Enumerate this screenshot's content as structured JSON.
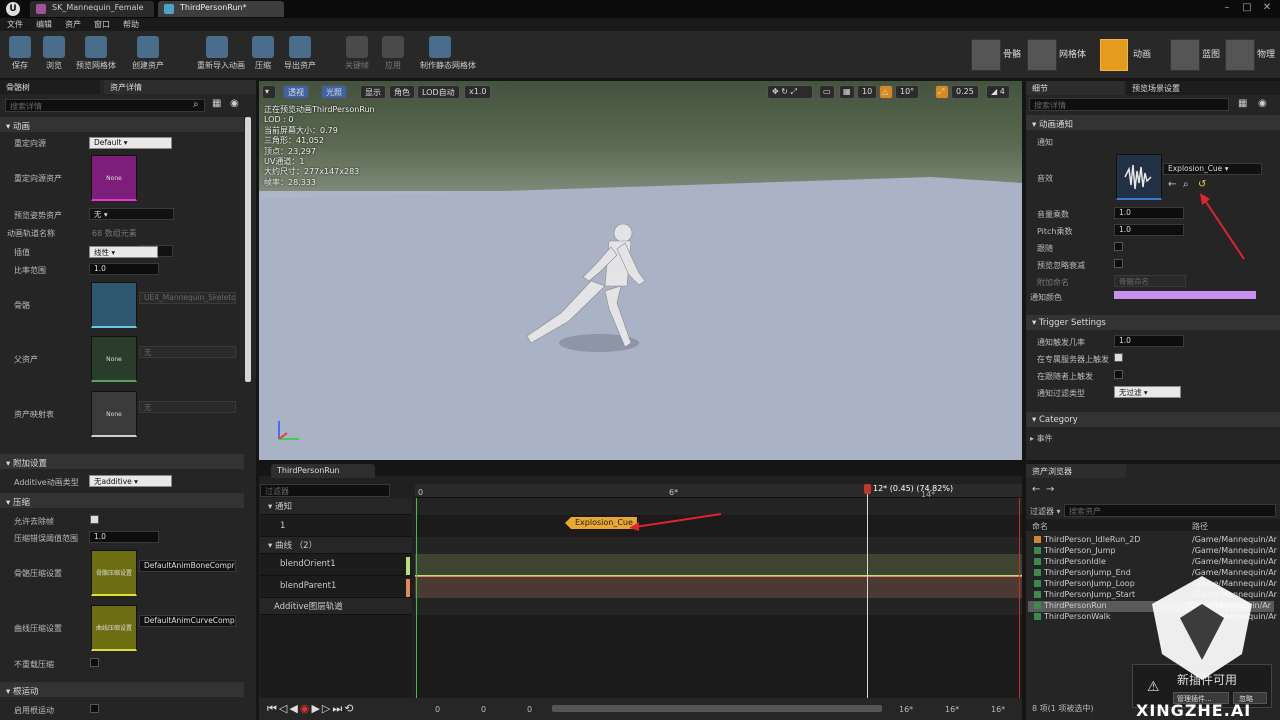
{
  "tabs": [
    "SK_Mannequin_Female",
    "ThirdPersonRun*"
  ],
  "menu": [
    "文件",
    "编辑",
    "资产",
    "窗口",
    "帮助"
  ],
  "toolbar": [
    {
      "label": "保存",
      "icon": "save-icon"
    },
    {
      "label": "浏览",
      "icon": "browse-icon"
    },
    {
      "label": "预览网格体",
      "icon": "preview-mesh-icon"
    },
    {
      "label": "创建资产",
      "icon": "create-asset-icon"
    },
    {
      "label": "重新导入动画",
      "icon": "reimport-icon"
    },
    {
      "label": "压缩",
      "icon": "compress-icon"
    },
    {
      "label": "导出资产",
      "icon": "export-icon"
    },
    {
      "label": "关键帧",
      "icon": "keyframe-icon",
      "disabled": true
    },
    {
      "label": "应用",
      "icon": "apply-icon",
      "disabled": true
    },
    {
      "label": "制作静态网格体",
      "icon": "static-mesh-icon"
    }
  ],
  "modes": [
    "骨骼",
    "网格体",
    "动画",
    "蓝图",
    "物理"
  ],
  "left": {
    "tabs": [
      "骨骼树",
      "资产详情"
    ],
    "search_placeholder": "搜索详情",
    "sec_animation": "动画",
    "retarget_source_label": "重定向源",
    "retarget_source_value": "Default",
    "retarget_asset_label": "重定向源资产",
    "retarget_asset_thumb": "None",
    "retarget_asset_value": "无",
    "preview_pose_label": "预览姿势资产",
    "preview_pose_value": "无",
    "track_names_label": "动画轨道名称",
    "track_names_value": "68 数组元素",
    "interp_label": "插值",
    "interp_value": "线性",
    "rate_label": "比率范围",
    "rate_value": "1.0",
    "skeleton_label": "骨骼",
    "skeleton_value": "UE4_Mannequin_Skeleton",
    "parent_label": "父资产",
    "parent_thumb": "None",
    "parent_value": "无",
    "mapping_label": "资产映射表",
    "mapping_thumb": "None",
    "mapping_value": "无",
    "sec_additive": "附加设置",
    "additive_type_label": "Additive动画类型",
    "additive_type_value": "无additive",
    "sec_compress": "压缩",
    "allow_remove_label": "允许去除帧",
    "compress_error_label": "压缩错误阈值范围",
    "compress_error_value": "1.0",
    "bone_compress_label": "骨骼压缩设置",
    "bone_compress_thumb": "骨骼压缩设置",
    "bone_compress_value": "DefaultAnimBoneCompre...",
    "curve_compress_label": "曲线压缩设置",
    "curve_compress_thumb": "曲线压缩设置",
    "curve_compress_value": "DefaultAnimCurveCompre...",
    "no_recompress_label": "不重载压缩",
    "sec_root": "根运动",
    "enable_root_label": "启用根运动"
  },
  "viewport": {
    "buttons": [
      "透视",
      "光照",
      "显示",
      "角色",
      "LOD自动",
      "x1.0"
    ],
    "right_values": [
      "10",
      "10°",
      "0.25",
      "4"
    ],
    "stats": [
      "正在预览动画ThirdPersonRun",
      "LOD : 0",
      "当前屏幕大小：0.79",
      "三角形：41,052",
      "顶点：23,297",
      "UV通道：1",
      "大约尺寸：277x147x283",
      "帧率：28.333"
    ]
  },
  "timeline": {
    "tab": "ThirdPersonRun",
    "filter_placeholder": "过滤器",
    "tracks": [
      {
        "label": "通知"
      },
      {
        "label": "1"
      },
      {
        "label": "曲线 （2）"
      },
      {
        "label": "blendOrient1",
        "color": "#b7e27a"
      },
      {
        "label": "blendParent1",
        "color": "#e08a5a"
      },
      {
        "label": "Additive图层轨道"
      }
    ],
    "ruler": [
      "0",
      "6*",
      "12* (0.45) (74.82%)",
      "14*"
    ],
    "notify_label": "Explosion_Cue",
    "playhead_fraction": 0.7482,
    "bottom_values": [
      "0",
      "0",
      "0",
      "16*",
      "16*",
      "16*"
    ]
  },
  "right": {
    "tabs": [
      "细节",
      "预览场景设置"
    ],
    "search_placeholder": "搜索详情",
    "sec_notify": "动画通知",
    "notify_label": "通知",
    "sound_label": "音效",
    "sound_value": "Explosion_Cue",
    "volume_label": "音量乘数",
    "volume_value": "1.0",
    "pitch_label": "Pitch乘数",
    "pitch_value": "1.0",
    "follow_label": "跟随",
    "preview_ignore_label": "预览忽略衰减",
    "attach_label": "附加命名",
    "attach_placeholder": "骨骼命名",
    "color_label": "通知颜色",
    "notify_color": "#c98ff0",
    "sec_trigger": "Trigger Settings",
    "chance_label": "通知触发几率",
    "chance_value": "1.0",
    "dedicated_label": "在专属服务器上触发",
    "follower_label": "在跟随者上触发",
    "filter_type_label": "通知过滤类型",
    "filter_type_value": "无过滤",
    "sec_category": "Category",
    "event_label": "事件"
  },
  "content": {
    "tab": "资产浏览器",
    "filter_label": "过滤器",
    "search_placeholder": "搜索资产",
    "col_name": "命名",
    "col_path": "路径",
    "items": [
      {
        "name": "ThirdPerson_IdleRun_2D",
        "path": "/Game/Mannequin/Ar"
      },
      {
        "name": "ThirdPerson_Jump",
        "path": "/Game/Mannequin/Ar"
      },
      {
        "name": "ThirdPersonIdle",
        "path": "/Game/Mannequin/Ar"
      },
      {
        "name": "ThirdPersonJump_End",
        "path": "/Game/Mannequin/Ar"
      },
      {
        "name": "ThirdPersonJump_Loop",
        "path": "/Game/Mannequin/Ar"
      },
      {
        "name": "ThirdPersonJump_Start",
        "path": "/Game/Mannequin/Ar"
      },
      {
        "name": "ThirdPersonRun",
        "path": "/Game/Mannequin/Ar"
      },
      {
        "name": "ThirdPersonWalk",
        "path": "/Game/Mannequin/Ar"
      }
    ],
    "count": "8 项(1 项被选中)",
    "plugin_text": "新插件可用",
    "manage_btn": "管理插件...",
    "ignore_btn": "忽略"
  },
  "watermark": "XINGZHE.AI"
}
